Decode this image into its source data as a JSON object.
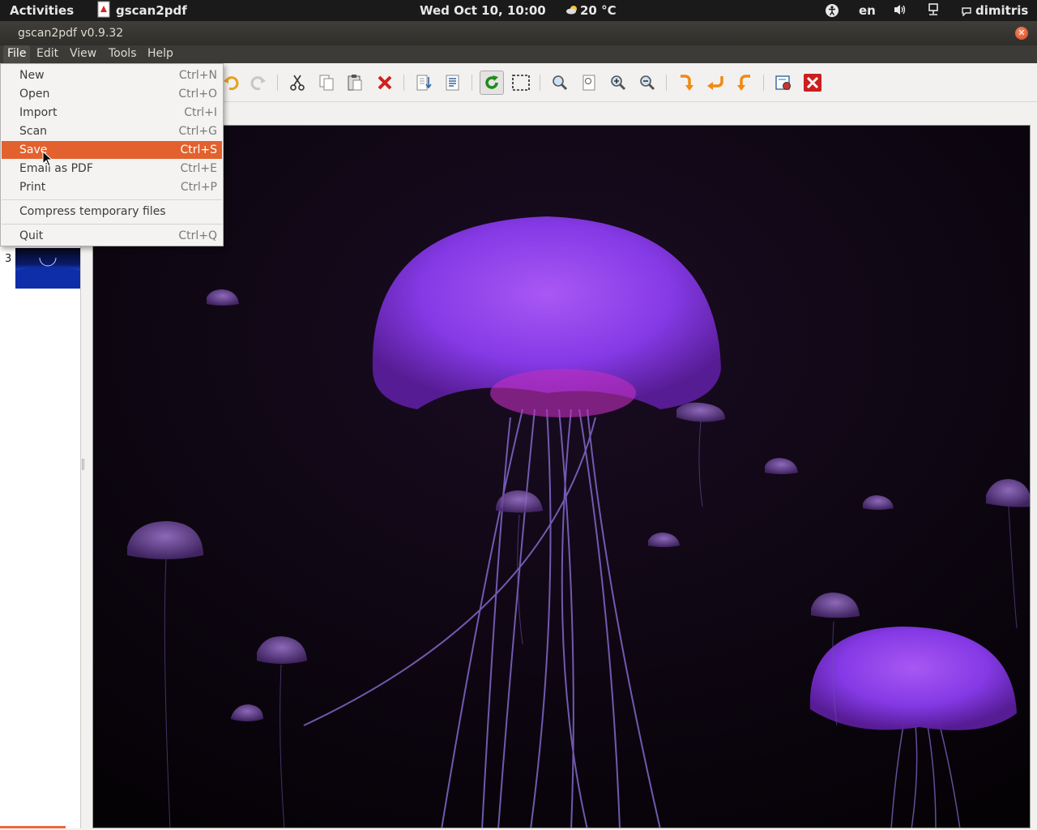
{
  "topbar": {
    "activities": "Activities",
    "app_name": "gscan2pdf",
    "clock": "Wed Oct 10, 10:00",
    "weather": "20 °C",
    "language": "en",
    "user": "dimitris",
    "icons": [
      "app-icon",
      "weather-cloud-icon",
      "accessibility-icon",
      "volume-icon",
      "network-icon",
      "user-status-icon"
    ]
  },
  "window": {
    "title": "gscan2pdf v0.9.32"
  },
  "menubar": {
    "items": [
      "File",
      "Edit",
      "View",
      "Tools",
      "Help"
    ]
  },
  "file_menu": {
    "items": [
      {
        "label": "New",
        "accel": "Ctrl+N"
      },
      {
        "label": "Open",
        "accel": "Ctrl+O"
      },
      {
        "label": "Import",
        "accel": "Ctrl+I"
      },
      {
        "label": "Scan",
        "accel": "Ctrl+G"
      },
      {
        "label": "Save",
        "accel": "Ctrl+S",
        "highlighted": true
      },
      {
        "label": "Email as PDF",
        "accel": "Ctrl+E"
      },
      {
        "label": "Print",
        "accel": "Ctrl+P"
      },
      {
        "label": "Compress temporary files",
        "accel": ""
      },
      {
        "label": "Quit",
        "accel": "Ctrl+Q"
      }
    ]
  },
  "toolbar": {
    "icons": [
      "undo-icon",
      "redo-icon",
      "cut-icon",
      "copy-icon",
      "paste-icon",
      "delete-icon",
      "sort-pages-icon",
      "renumber-icon",
      "rotate-refresh-icon",
      "select-area-icon",
      "zoom-fit-icon",
      "zoom-100-icon",
      "zoom-in-icon",
      "zoom-out-icon",
      "rotate-90-icon",
      "rotate-180-icon",
      "rotate-270-icon",
      "scan-preferences-icon",
      "quit-icon"
    ]
  },
  "thumbnails": {
    "visible_page_number": "3"
  },
  "colors": {
    "menu_highlight": "#e2612e",
    "topbar_bg": "#1a1a1a",
    "titlebar_bg": "#3c3b37",
    "viewer_bg": "#0b0509"
  }
}
